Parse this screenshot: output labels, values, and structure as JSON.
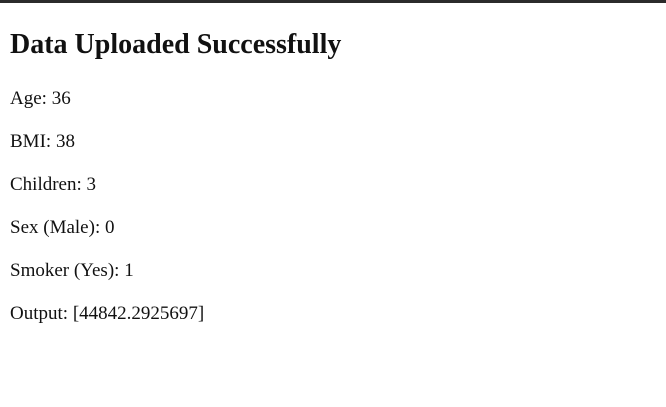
{
  "page": {
    "title": "Data Uploaded Successfully"
  },
  "fields": [
    {
      "label": "Age",
      "value": "36"
    },
    {
      "label": "BMI",
      "value": "38"
    },
    {
      "label": "Children",
      "value": "3"
    },
    {
      "label": "Sex (Male)",
      "value": "0"
    },
    {
      "label": "Smoker (Yes)",
      "value": "1"
    },
    {
      "label": "Output",
      "value": "[44842.2925697]"
    }
  ],
  "separator": ": "
}
